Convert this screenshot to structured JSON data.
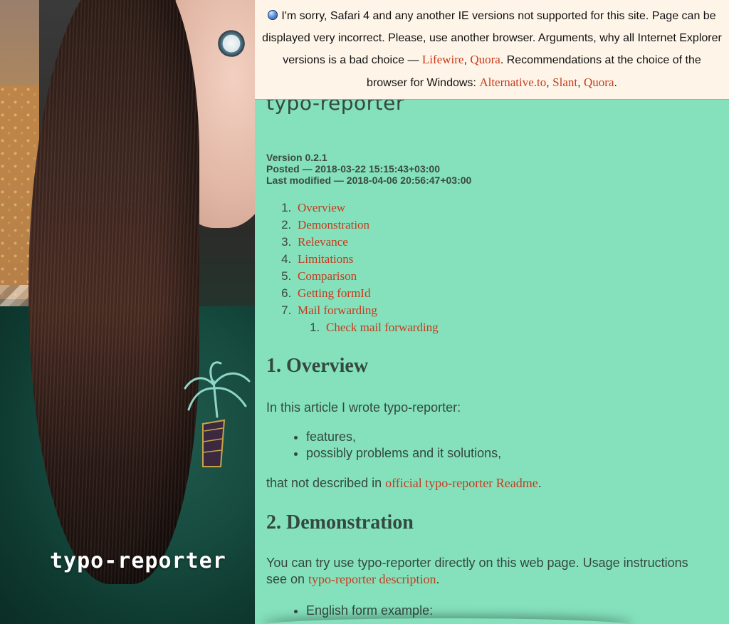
{
  "hero": {
    "title": "typo-reporter"
  },
  "warning": {
    "text_1": "I'm sorry, Safari 4 and any another IE versions not supported for this site. Page can be displayed very incorrect. Please, use another browser. Arguments, why all Internet Explorer versions is a bad choice — ",
    "link_lifewire": "Lifewire",
    "sep_1": ", ",
    "link_quora_1": "Quora",
    "text_2": ". Recommendations at the choice of the browser for Windows: ",
    "link_alternative": "Alternative.to",
    "sep_2": ", ",
    "link_slant": "Slant",
    "sep_3": ", ",
    "link_quora_2": "Quora",
    "text_3": "."
  },
  "article": {
    "title": "typo-reporter",
    "version": "Version 0.2.1",
    "posted": "Posted — 2018-03-22 15:15:43+03:00",
    "modified": "Last modified — 2018-04-06 20:56:47+03:00"
  },
  "toc": {
    "items": [
      {
        "label": "Overview"
      },
      {
        "label": "Demonstration"
      },
      {
        "label": "Relevance"
      },
      {
        "label": "Limitations"
      },
      {
        "label": "Comparison"
      },
      {
        "label": "Getting formId"
      },
      {
        "label": "Mail forwarding"
      }
    ],
    "subitems": [
      {
        "label": "Check mail forwarding"
      }
    ]
  },
  "overview": {
    "heading": "1. Overview",
    "intro": "In this article I wrote typo-reporter:",
    "bullets": [
      "features,",
      "possibly problems and it solutions,"
    ],
    "outro_text": "that not described in ",
    "outro_link": "official typo-reporter Readme",
    "outro_end": "."
  },
  "demonstration": {
    "heading": "2. Demonstration",
    "text": "You can try use typo-reporter directly on this web page. Usage instructions see on ",
    "link": "typo-reporter description",
    "end": ".",
    "bullet": "English form example:"
  },
  "colors": {
    "background": "#84e1bc",
    "link": "#c63a1c",
    "text": "#34483f",
    "banner": "#fef5e8"
  },
  "icons": {
    "banner_icon": "globe-icon"
  }
}
